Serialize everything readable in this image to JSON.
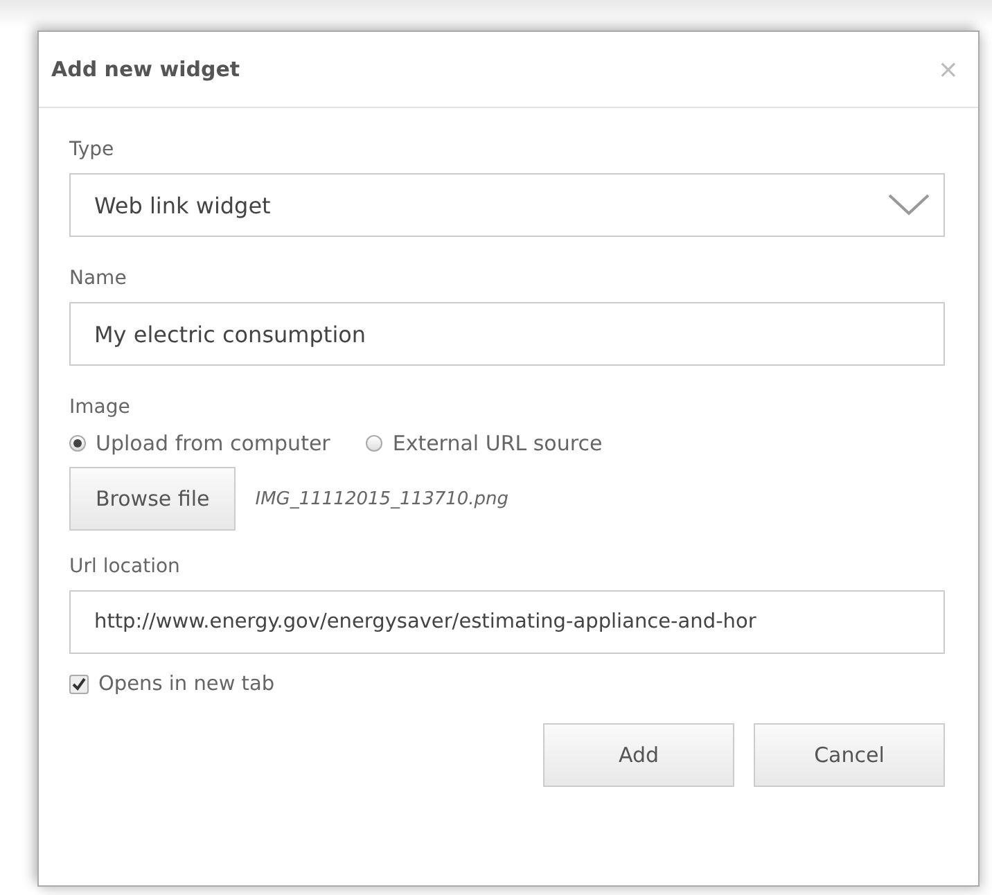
{
  "dialog": {
    "title": "Add new widget",
    "close": "×"
  },
  "type": {
    "label": "Type",
    "value": "Web link widget"
  },
  "name": {
    "label": "Name",
    "value": "My electric consumption"
  },
  "image": {
    "label": "Image",
    "options": [
      {
        "label": "Upload from computer",
        "selected": true
      },
      {
        "label": "External URL source",
        "selected": false
      }
    ],
    "browse_button": "Browse file",
    "file_name": "IMG_11112015_113710.png"
  },
  "url": {
    "label": "Url location",
    "value": "http://www.energy.gov/energysaver/estimating-appliance-and-hor"
  },
  "opens_in_new_tab": {
    "label": "Opens in new tab",
    "checked": true
  },
  "buttons": [
    "Add",
    "Cancel"
  ]
}
